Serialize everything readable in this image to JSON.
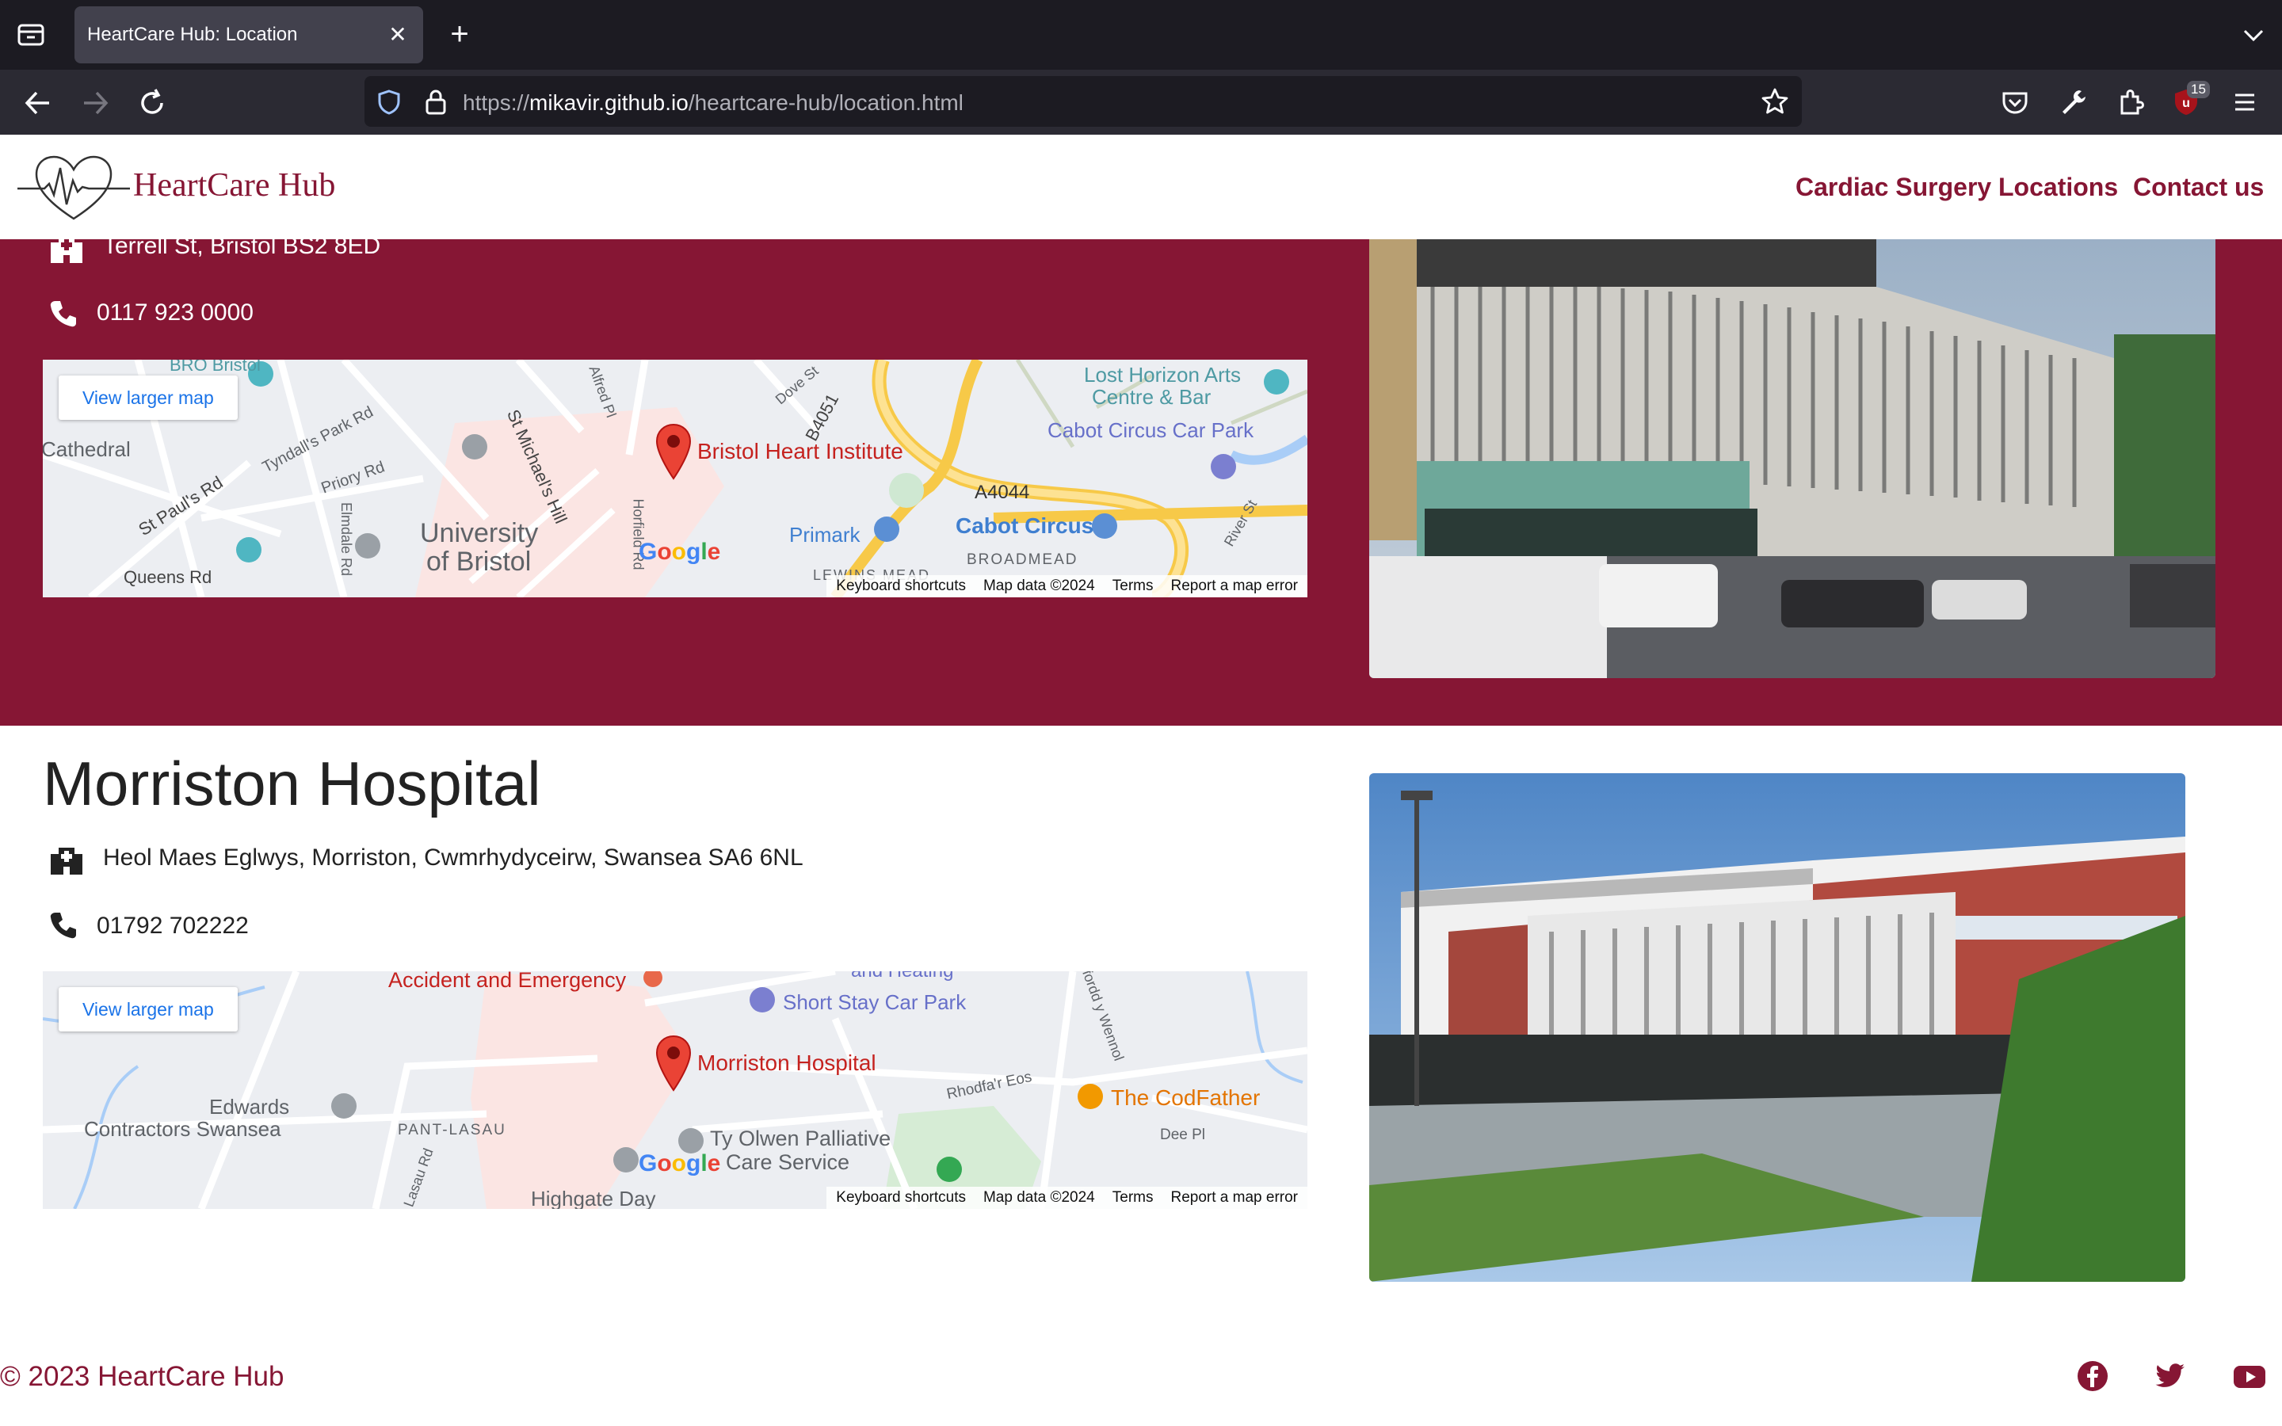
{
  "browser": {
    "tab_title": "HeartCare Hub: Location",
    "url_prefix": "https://",
    "url_host": "mikavir.github.io",
    "url_path": "/heartcare-hub/location.html",
    "extension_badge": "15"
  },
  "site": {
    "brand": "HeartCare Hub",
    "nav": [
      "Cardiac Surgery",
      "Locations",
      "Contact us"
    ],
    "brand_color": "#861634"
  },
  "hospitals": [
    {
      "address": "Terrell St, Bristol BS2 8ED",
      "phone": "0117 923 0000",
      "map": {
        "button": "View larger map",
        "pin_label": "Bristol Heart Institute",
        "labels": [
          "Cathedral",
          "Tyndall's Park Rd",
          "Priory Rd",
          "St Paul's Rd",
          "Queens Rd",
          "Elmdale Rd",
          "St Michael's Hill",
          "Alfred Pl",
          "Dove St",
          "B4051",
          "Horfield Rd",
          "Lost Horizon Arts",
          "Centre & Bar",
          "Cabot Circus Car Park",
          "A4044",
          "Primark",
          "Cabot Circus",
          "BROADMEAD",
          "River St",
          "University",
          "of Bristol",
          "LEWINS MEAD",
          "BRO Bristol"
        ],
        "footer": [
          "Keyboard shortcuts",
          "Map data ©2024",
          "Terms",
          "Report a map error"
        ]
      }
    },
    {
      "name": "Morriston Hospital",
      "address": "Heol Maes Eglwys, Morriston, Cwmrhydyceirw, Swansea SA6 6NL",
      "phone": "01792 702222",
      "map": {
        "button": "View larger map",
        "pin_label": "Morriston Hospital",
        "labels": [
          "Accident and Emergency",
          "and Heating",
          "Short Stay Car Park",
          "Rhodfa'r Eos",
          "The CodFather",
          "Dee Pl",
          "Edwards",
          "Contractors Swansea",
          "PANT-LASAU",
          "Ty Olwen Palliative",
          "Care Service",
          "Highgate Day",
          "Lasau Rd",
          "Ffordd y Wennol"
        ],
        "footer": [
          "Keyboard shortcuts",
          "Map data ©2024",
          "Terms",
          "Report a map error"
        ]
      }
    }
  ],
  "footer": {
    "copyright": "© 2023 HeartCare Hub",
    "social": [
      "facebook-icon",
      "twitter-icon",
      "youtube-icon"
    ]
  }
}
